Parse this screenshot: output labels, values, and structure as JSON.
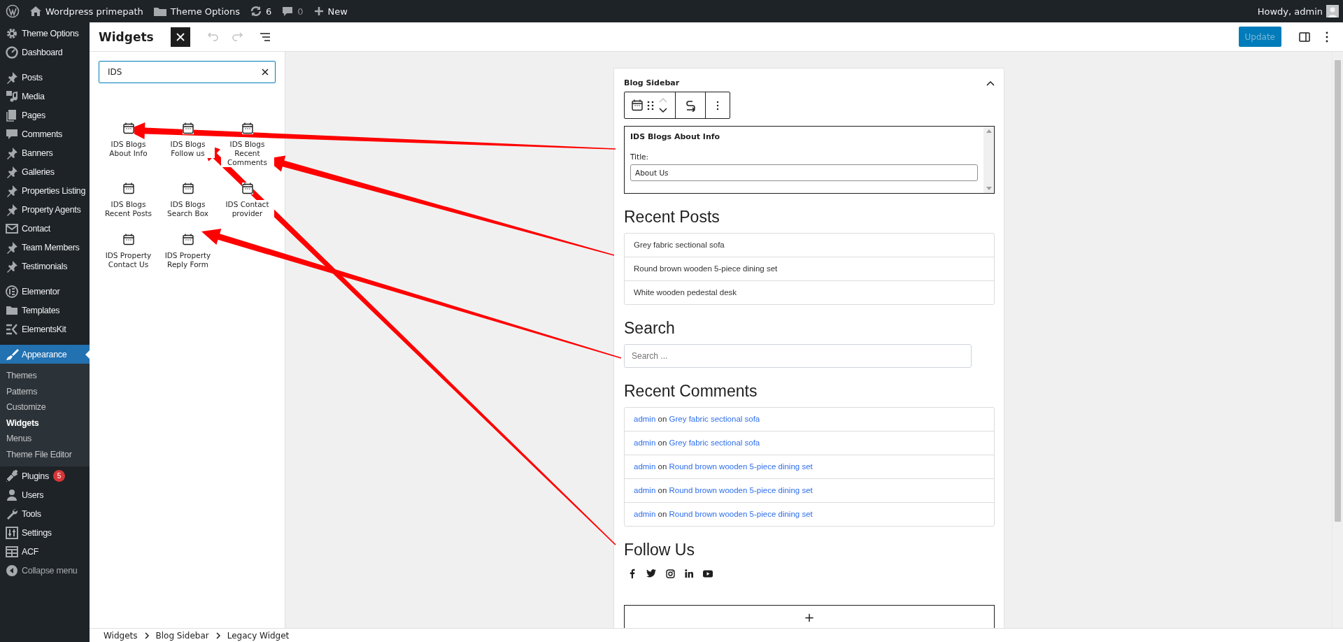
{
  "admin_bar": {
    "site": "Wordpress primepath",
    "theme_options": "Theme Options",
    "updates": "6",
    "comments": "0",
    "new": "New",
    "greeting": "Howdy, admin"
  },
  "sidebar": {
    "groups": [
      [
        {
          "label": "Theme Options",
          "selected": false
        },
        {
          "label": "Dashboard",
          "selected": false
        }
      ],
      [
        {
          "label": "Posts",
          "selected": false
        },
        {
          "label": "Media",
          "selected": false
        },
        {
          "label": "Pages",
          "selected": false
        },
        {
          "label": "Comments",
          "selected": false
        },
        {
          "label": "Banners",
          "selected": false
        },
        {
          "label": "Galleries",
          "selected": false
        },
        {
          "label": "Properties Listing",
          "selected": false
        },
        {
          "label": "Property Agents",
          "selected": false
        },
        {
          "label": "Contact",
          "selected": false
        },
        {
          "label": "Team Members",
          "selected": false
        },
        {
          "label": "Testimonials",
          "selected": false
        }
      ],
      [
        {
          "label": "Elementor",
          "selected": false
        },
        {
          "label": "Templates",
          "selected": false
        },
        {
          "label": "ElementsKit",
          "selected": false
        }
      ],
      [
        {
          "label": "Appearance",
          "selected": true,
          "children": [
            {
              "label": "Themes",
              "selected": false
            },
            {
              "label": "Patterns",
              "selected": false
            },
            {
              "label": "Customize",
              "selected": false
            },
            {
              "label": "Widgets",
              "selected": true
            },
            {
              "label": "Menus",
              "selected": false
            },
            {
              "label": "Theme File Editor",
              "selected": false
            }
          ]
        },
        {
          "label": "Plugins",
          "selected": false,
          "badge": "5"
        },
        {
          "label": "Users",
          "selected": false
        },
        {
          "label": "Tools",
          "selected": false
        },
        {
          "label": "Settings",
          "selected": false
        },
        {
          "label": "ACF",
          "selected": false
        }
      ]
    ],
    "collapse": "Collapse menu"
  },
  "header": {
    "title": "Widgets",
    "inserter_open": true,
    "update": "Update",
    "update_disabled": true
  },
  "inserter": {
    "search": {
      "value": "IDS"
    },
    "blocks": [
      {
        "label": "IDS Blogs About Info"
      },
      {
        "label": "IDS Blogs Follow us"
      },
      {
        "label": "IDS Blogs Recent Comments"
      },
      {
        "label": "IDS Blogs Recent Posts"
      },
      {
        "label": "IDS Blogs Search Box"
      },
      {
        "label": "IDS Contact provider"
      },
      {
        "label": "IDS Property Contact Us"
      },
      {
        "label": "IDS Property Reply Form"
      }
    ]
  },
  "editor": {
    "area_title": "Blog Sidebar",
    "expanded": true,
    "legacy_widget": {
      "name": "IDS Blogs About Info",
      "field_label": "Title:",
      "field_value": "About Us"
    },
    "sections": [
      {
        "kind": "posts",
        "heading": "Recent Posts",
        "items": [
          "Grey fabric sectional sofa",
          "Round brown wooden 5-piece dining set",
          "White wooden pedestal desk"
        ]
      },
      {
        "kind": "search",
        "heading": "Search",
        "placeholder": "Search ..."
      },
      {
        "kind": "comments",
        "heading": "Recent Comments",
        "items": [
          {
            "author": "admin",
            "connector": "on",
            "post": "Grey fabric sectional sofa"
          },
          {
            "author": "admin",
            "connector": "on",
            "post": "Grey fabric sectional sofa"
          },
          {
            "author": "admin",
            "connector": "on",
            "post": "Round brown wooden 5-piece dining set"
          },
          {
            "author": "admin",
            "connector": "on",
            "post": "Round brown wooden 5-piece dining set"
          },
          {
            "author": "admin",
            "connector": "on",
            "post": "Round brown wooden 5-piece dining set"
          }
        ]
      },
      {
        "kind": "social",
        "heading": "Follow Us"
      }
    ],
    "appender": "+"
  },
  "breadcrumb": [
    "Widgets",
    "Blog Sidebar",
    "Legacy Widget"
  ]
}
